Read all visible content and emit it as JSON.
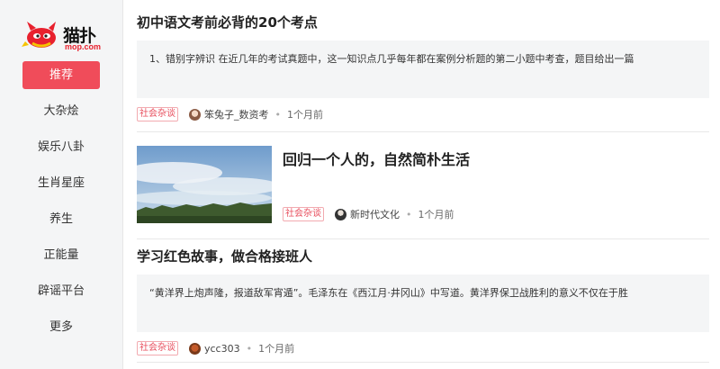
{
  "brand": {
    "logo_text": "猫扑",
    "logo_sub": "mop.com",
    "accent": "#f04c5a"
  },
  "sidebar": {
    "items": [
      {
        "label": "推荐",
        "active": true
      },
      {
        "label": "大杂烩"
      },
      {
        "label": "娱乐八卦"
      },
      {
        "label": "生肖星座"
      },
      {
        "label": "养生"
      },
      {
        "label": "正能量"
      },
      {
        "label": "辟谣平台"
      },
      {
        "label": "更多"
      }
    ]
  },
  "articles": [
    {
      "title": "初中语文考前必背的20个考点",
      "summary": "1、错别字辨识 在近几年的考试真题中，这一知识点几乎每年都在案例分析题的第二小题中考查，题目给出一篇",
      "tag": "社会杂谈",
      "author": "笨兔子_数资考",
      "dot": "•",
      "time": "1个月前"
    },
    {
      "title": "回归一个人的，自然简朴生活",
      "tag": "社会杂谈",
      "author": "新时代文化",
      "dot": "•",
      "time": "1个月前",
      "thumbnail": "sky-landscape"
    },
    {
      "title": "学习红色故事，做合格接班人",
      "summary": "“黄洋界上炮声隆，报道敌军宵遁”。毛泽东在《西江月·井冈山》中写道。黄洋界保卫战胜利的意义不仅在于胜",
      "tag": "社会杂谈",
      "author": "ycc303",
      "dot": "•",
      "time": "1个月前"
    }
  ]
}
